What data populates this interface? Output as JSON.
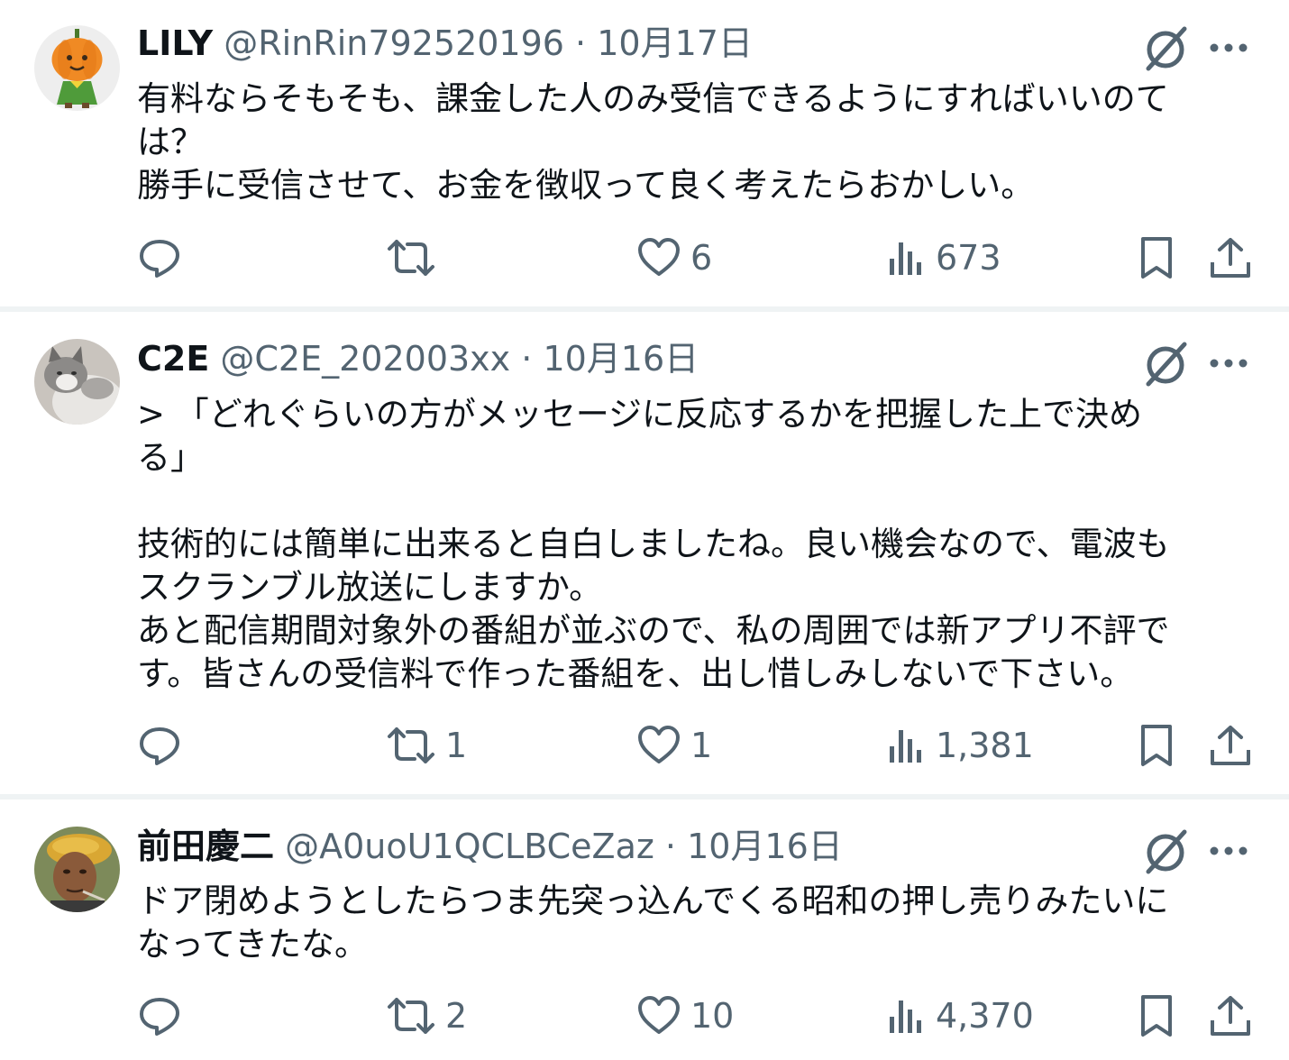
{
  "tweets": [
    {
      "name": "LILY",
      "handle": "@RinRin792520196",
      "separator": "·",
      "date": "10月17日",
      "avatar_icon": "pumpkin-character-icon",
      "lines": [
        "有料ならそもそも、課金した人のみ受信できるようにすればいいのて",
        "は？",
        "勝手に受信させて、お金を徴収って良く考えたらおかしい。"
      ],
      "replies": "",
      "retweets": "",
      "likes": "6",
      "views": "673"
    },
    {
      "name": "C2E",
      "handle": "@C2E_202003xx",
      "separator": "·",
      "date": "10月16日",
      "avatar_icon": "cat-photo-icon",
      "lines": [
        "> 「どれぐらいの方がメッセージに反応するかを把握した上で決め",
        "る」",
        "",
        "技術的には簡単に出来ると自白しましたね。良い機会なので、電波も",
        "スクランブル放送にしますか。",
        "あと配信期間対象外の番組が並ぶので、私の周囲では新アプリ不評で",
        "す。皆さんの受信料で作った番組を、出し惜しみしないで下さい。"
      ],
      "replies": "",
      "retweets": "1",
      "likes": "1",
      "views": "1,381"
    },
    {
      "name": "前田慶二",
      "handle": "@A0uoU1QCLBCeZaz",
      "separator": "·",
      "date": "10月16日",
      "avatar_icon": "man-portrait-icon",
      "lines": [
        "ドア閉めようとしたらつま先突っ込んでくる昭和の押し売りみたいに",
        "なってきたな。"
      ],
      "replies": "",
      "retweets": "2",
      "likes": "10",
      "views": "4,370"
    }
  ],
  "icons": {
    "reply": "reply-icon",
    "retweet": "retweet-icon",
    "like": "heart-icon",
    "views": "views-icon",
    "bookmark": "bookmark-icon",
    "share": "share-icon",
    "grok": "grok-icon",
    "more": "more-icon"
  },
  "colors": {
    "text": "#0f1419",
    "secondary": "#536471",
    "divider": "#eff3f4"
  }
}
